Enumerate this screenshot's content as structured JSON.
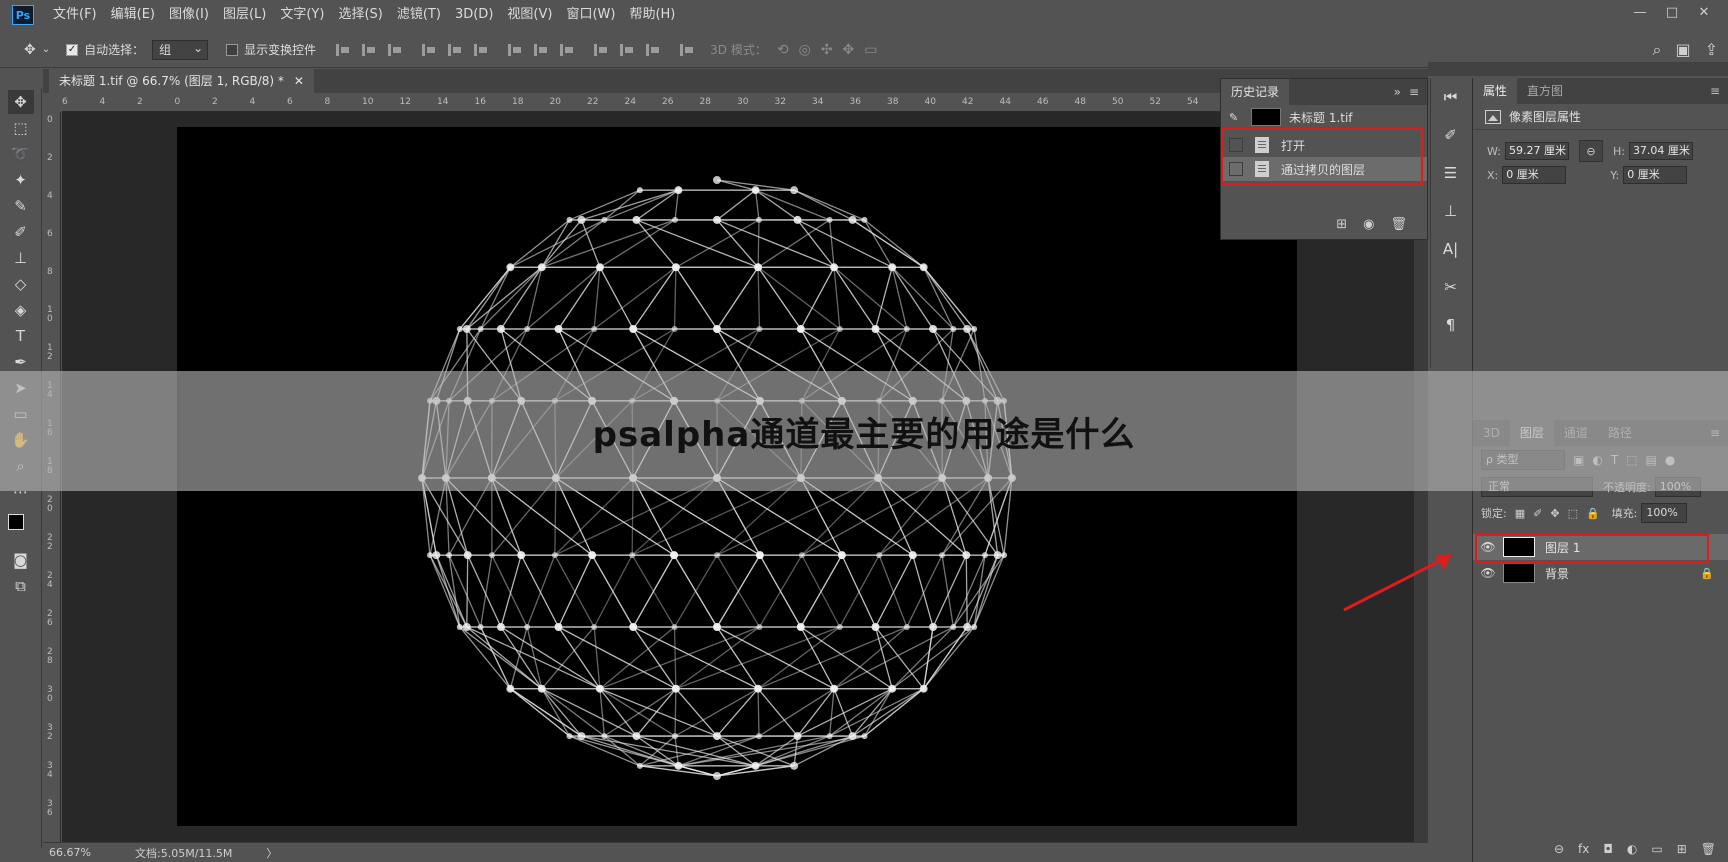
{
  "app": {
    "logo": "Ps"
  },
  "menu": [
    "文件(F)",
    "编辑(E)",
    "图像(I)",
    "图层(L)",
    "文字(Y)",
    "选择(S)",
    "滤镜(T)",
    "3D(D)",
    "视图(V)",
    "窗口(W)",
    "帮助(H)"
  ],
  "window_controls": [
    "—",
    "□",
    "✕"
  ],
  "options": {
    "auto_select_label": "自动选择：",
    "auto_select_value": "组",
    "show_transform_label": "显示变换控件",
    "mode3d_label": "3D 模式："
  },
  "document": {
    "tab_title": "未标题 1.tif @ 66.7% (图层 1, RGB/8) *",
    "close": "✕"
  },
  "ruler_h": [
    "6",
    "4",
    "2",
    "0",
    "2",
    "4",
    "6",
    "8",
    "10",
    "12",
    "14",
    "16",
    "18",
    "20",
    "22",
    "24",
    "26",
    "28",
    "30",
    "32",
    "34",
    "36",
    "38",
    "40",
    "42",
    "44",
    "46",
    "48",
    "50",
    "52",
    "54"
  ],
  "ruler_v": [
    "0",
    "2",
    "4",
    "6",
    "8",
    "1\n0",
    "1\n2",
    "1\n4",
    "1\n6",
    "1\n8",
    "2\n0",
    "2\n2",
    "2\n4",
    "2\n6",
    "2\n8",
    "3\n0",
    "3\n2",
    "3\n4",
    "3\n6"
  ],
  "status": {
    "zoom": "66.67%",
    "doc_info": "文档:5.05M/11.5M",
    "arrow": "〉"
  },
  "history": {
    "title": "历史记录",
    "snapshot": "未标题 1.tif",
    "items": [
      "打开",
      "通过拷贝的图层"
    ]
  },
  "properties": {
    "tabs": [
      "属性",
      "直方图"
    ],
    "title": "像素图层属性",
    "w_label": "W:",
    "w_value": "59.27 厘米",
    "h_label": "H:",
    "h_value": "37.04 厘米",
    "x_label": "X:",
    "x_value": "0 厘米",
    "y_label": "Y:",
    "y_value": "0 厘米"
  },
  "layers": {
    "tabs": [
      "3D",
      "图层",
      "通道",
      "路径"
    ],
    "filter_kind": "ρ 类型",
    "blend_mode": "正常",
    "opacity_label": "不透明度:",
    "opacity_value": "100%",
    "lock_label": "锁定:",
    "fill_label": "填充:",
    "fill_value": "100%",
    "items": [
      "图层 1",
      "背景"
    ]
  },
  "banner": {
    "text": "psalpha通道最主要的用途是什么"
  },
  "colors": {
    "accent_red": "#e01b1b",
    "ps_blue": "#31a8ff"
  }
}
